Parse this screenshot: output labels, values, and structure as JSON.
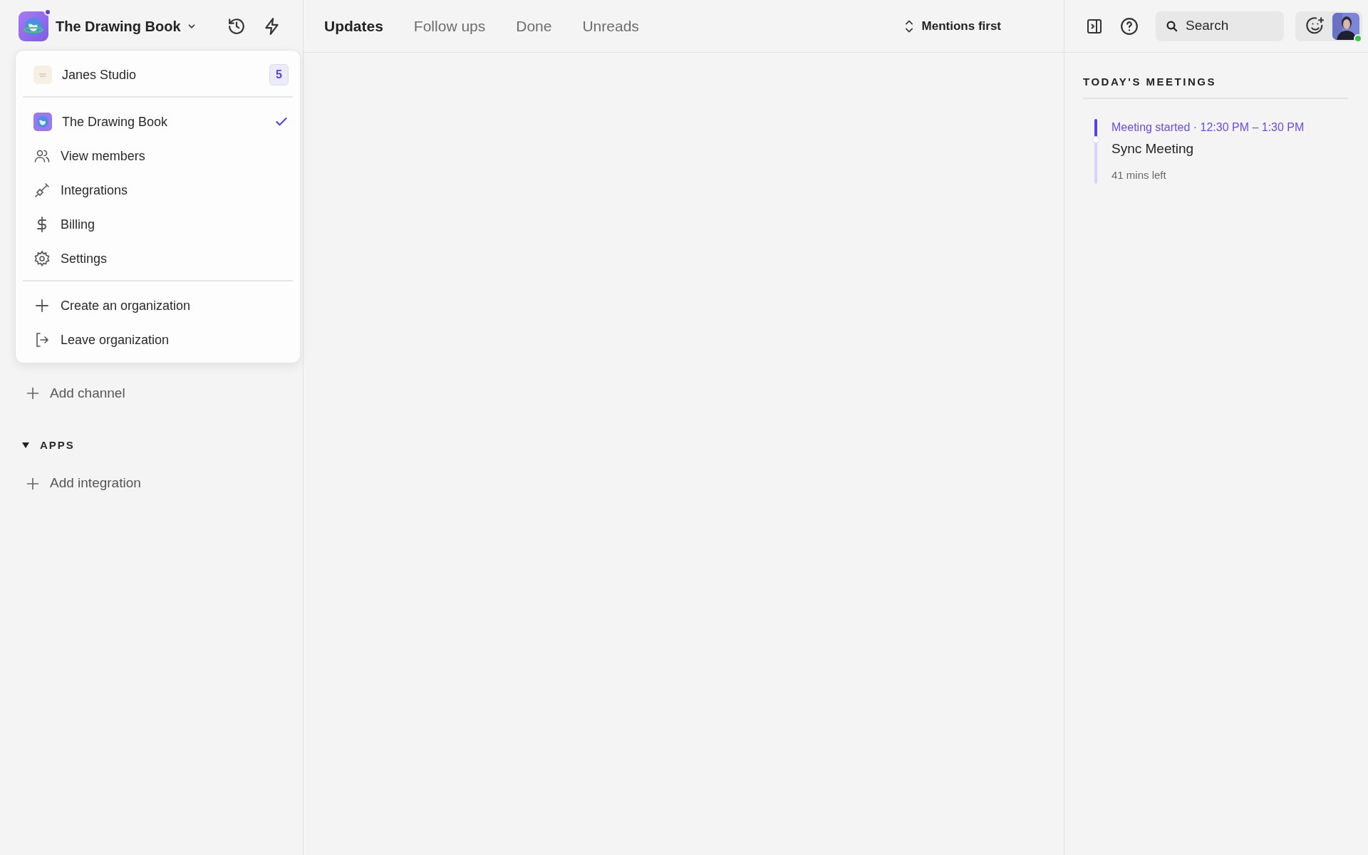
{
  "workspace": {
    "name": "The Drawing Book",
    "notification": true
  },
  "header_tabs": [
    {
      "label": "Updates",
      "selected": true
    },
    {
      "label": "Follow ups",
      "selected": false
    },
    {
      "label": "Done",
      "selected": false
    },
    {
      "label": "Unreads",
      "selected": false
    }
  ],
  "sort": {
    "label": "Mentions first"
  },
  "search": {
    "placeholder": "Search"
  },
  "user": {
    "online": true
  },
  "org_menu": {
    "items": [
      {
        "kind": "org",
        "label": "Janes Studio",
        "badge": "5",
        "selected": false
      },
      {
        "kind": "divider"
      },
      {
        "kind": "org",
        "label": "The Drawing Book",
        "selected": true
      },
      {
        "kind": "action",
        "label": "View members"
      },
      {
        "kind": "action",
        "label": "Integrations"
      },
      {
        "kind": "action",
        "label": "Billing"
      },
      {
        "kind": "action",
        "label": "Settings"
      },
      {
        "kind": "divider"
      },
      {
        "kind": "action",
        "label": "Create an organization"
      },
      {
        "kind": "action",
        "label": "Leave organization"
      }
    ]
  },
  "sidebar": {
    "add_channel": "Add channel",
    "apps": {
      "title": "APPS",
      "expanded": true,
      "add": "Add integration"
    }
  },
  "meetings": {
    "title": "TODAY'S MEETINGS",
    "items": [
      {
        "status": "Meeting started",
        "separator": "·",
        "time": "12:30 PM – 1:30 PM",
        "title": "Sync Meeting",
        "remaining": "41 mins left",
        "level": 0.32
      }
    ]
  }
}
